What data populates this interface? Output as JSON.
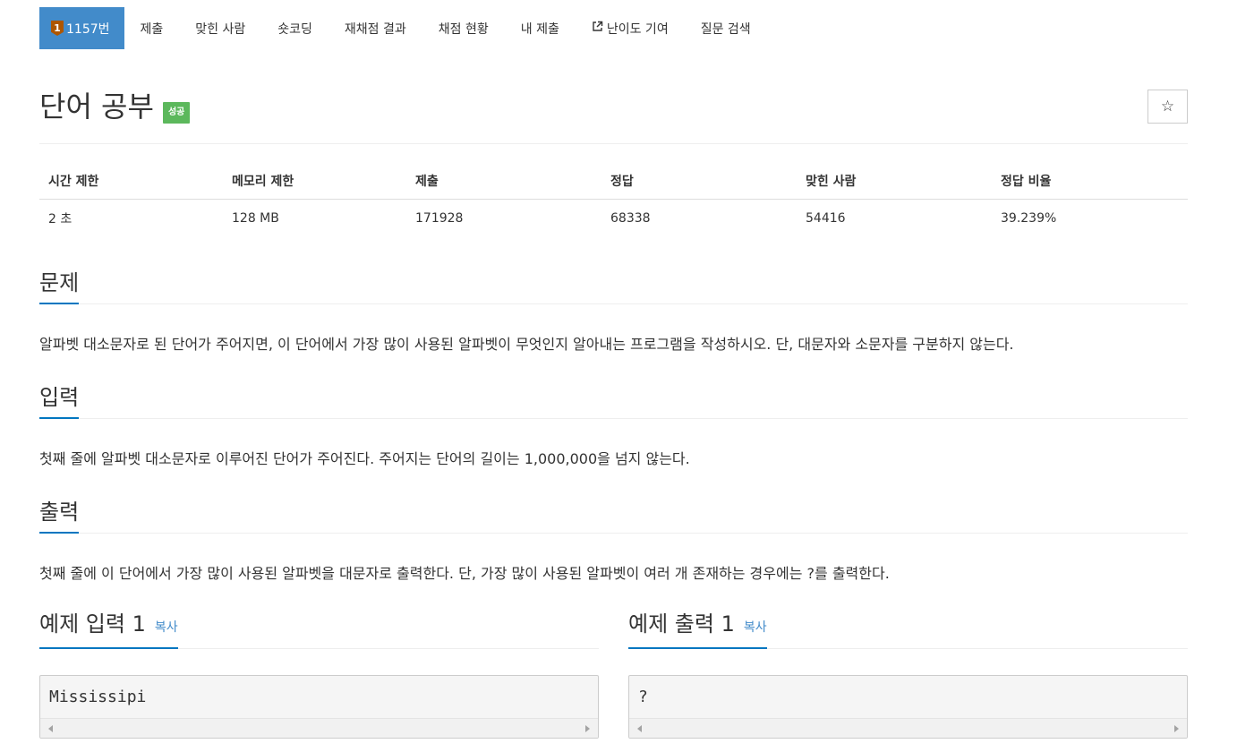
{
  "nav": {
    "problem": {
      "tier": "1",
      "number": "1157번"
    },
    "items": [
      {
        "label": "제출"
      },
      {
        "label": "맞힌 사람"
      },
      {
        "label": "숏코딩"
      },
      {
        "label": "재채점 결과"
      },
      {
        "label": "채점 현황"
      },
      {
        "label": "내 제출"
      },
      {
        "label": "난이도 기여",
        "icon": "external-link-icon"
      },
      {
        "label": "질문 검색"
      }
    ]
  },
  "title": {
    "text": "단어 공부",
    "badge": "성공",
    "star": "☆"
  },
  "info": {
    "headers": [
      "시간 제한",
      "메모리 제한",
      "제출",
      "정답",
      "맞힌 사람",
      "정답 비율"
    ],
    "values": [
      "2 초",
      "128 MB",
      "171928",
      "68338",
      "54416",
      "39.239%"
    ]
  },
  "sections": {
    "problem": {
      "title": "문제",
      "text": "알파벳 대소문자로 된 단어가 주어지면, 이 단어에서 가장 많이 사용된 알파벳이 무엇인지 알아내는 프로그램을 작성하시오. 단, 대문자와 소문자를 구분하지 않는다."
    },
    "input": {
      "title": "입력",
      "text": "첫째 줄에 알파벳 대소문자로 이루어진 단어가 주어진다. 주어지는 단어의 길이는 1,000,000을 넘지 않는다."
    },
    "output": {
      "title": "출력",
      "text": "첫째 줄에 이 단어에서 가장 많이 사용된 알파벳을 대문자로 출력한다. 단, 가장 많이 사용된 알파벳이 여러 개 존재하는 경우에는 ?를 출력한다."
    }
  },
  "samples": {
    "input": {
      "title": "예제 입력 1",
      "copy": "복사",
      "code": "Mississipi"
    },
    "output": {
      "title": "예제 출력 1",
      "copy": "복사",
      "code": "?"
    }
  },
  "colors": {
    "nav_active": "#428bca",
    "success": "#5cb85c",
    "accent": "#0076c0",
    "tier_bronze": "#ad5600"
  }
}
